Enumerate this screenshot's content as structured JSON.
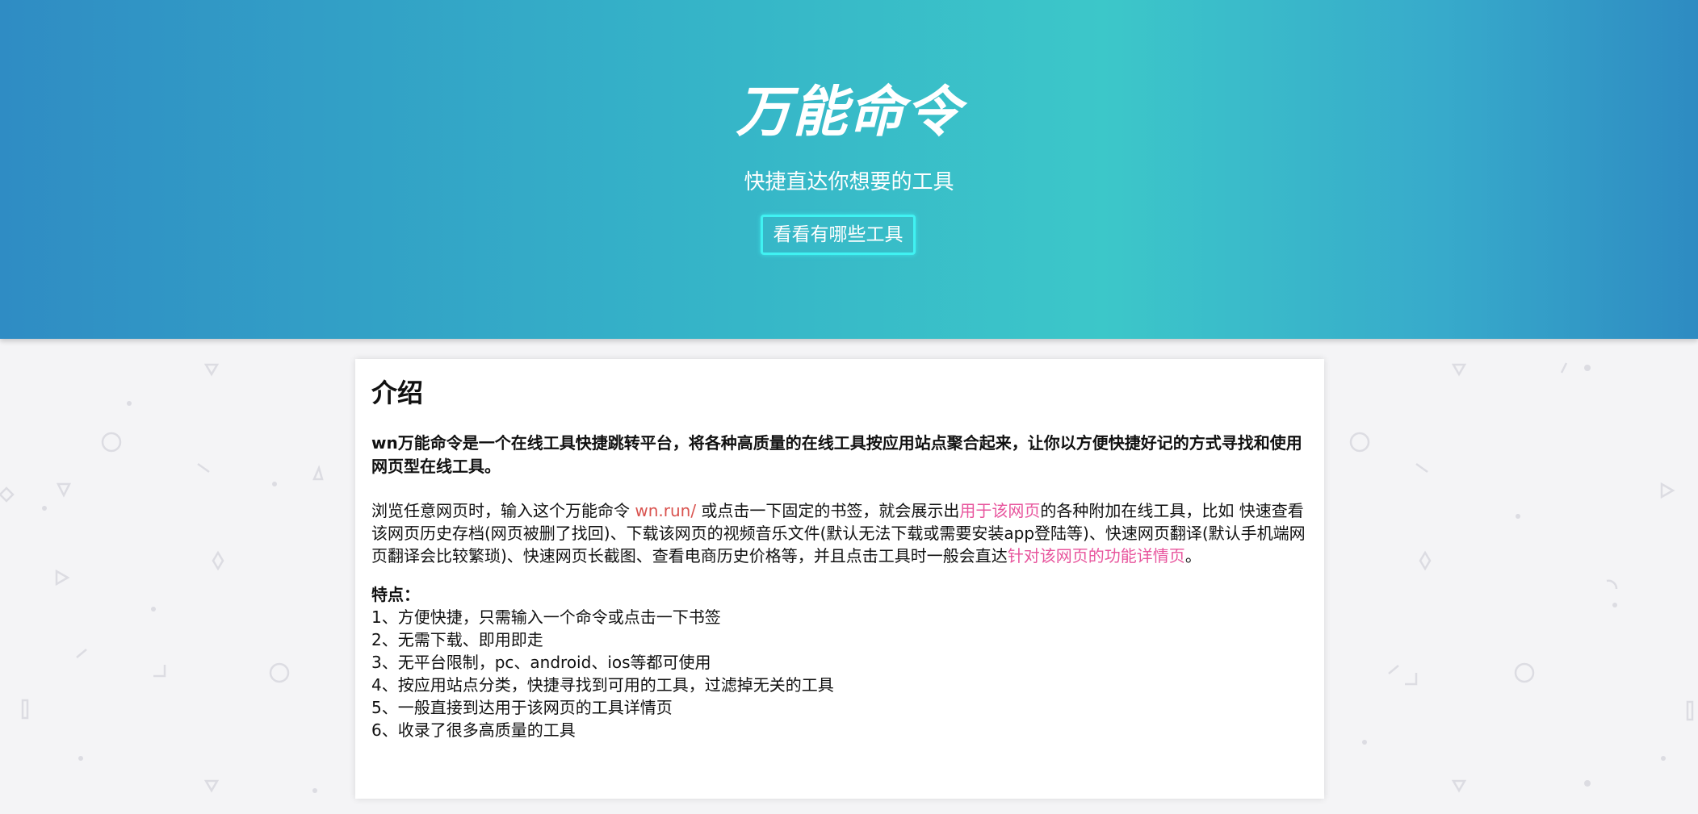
{
  "hero": {
    "title": "万能命令",
    "subtitle": "快捷直达你想要的工具",
    "button_label": "看看有哪些工具"
  },
  "intro": {
    "heading": "介绍",
    "bold_text": "wn万能命令是一个在线工具快捷跳转平台，将各种高质量的在线工具按应用站点聚合起来，让你以方便快捷好记的方式寻找和使用网页型在线工具。",
    "desc_part1": "浏览任意网页时，输入这个万能命令 ",
    "desc_link1": "wn.run/",
    "desc_part2": " 或点击一下固定的书签，就会展示出",
    "desc_link2": "用于该网页",
    "desc_part3": "的各种附加在线工具，比如 快速查看该网页历史存档(网页被删了找回)、下载该网页的视频音乐文件(默认无法下载或需要安装app登陆等)、快速网页翻译(默认手机端网页翻译会比较繁琐)、快速网页长截图、查看电商历史价格等，并且点击工具时一般会直达",
    "desc_link3": "针对该网页的功能详情页",
    "desc_part4": "。"
  },
  "features": {
    "title": "特点：",
    "items": [
      "1、方便快捷，只需输入一个命令或点击一下书签",
      "2、无需下载、即用即走",
      "3、无平台限制，pc、android、ios等都可使用",
      "4、按应用站点分类，快捷寻找到可用的工具，过滤掉无关的工具",
      "5、一般直接到达用于该网页的工具详情页",
      "6、收录了很多高质量的工具"
    ]
  },
  "colors": {
    "hero_gradient_start": "#2f8cc4",
    "hero_gradient_mid": "#3cc7c9",
    "button_border": "#40f2f2",
    "link_red": "#d9534f",
    "link_pink": "#e8559d",
    "page_background": "#f4f4f6"
  }
}
